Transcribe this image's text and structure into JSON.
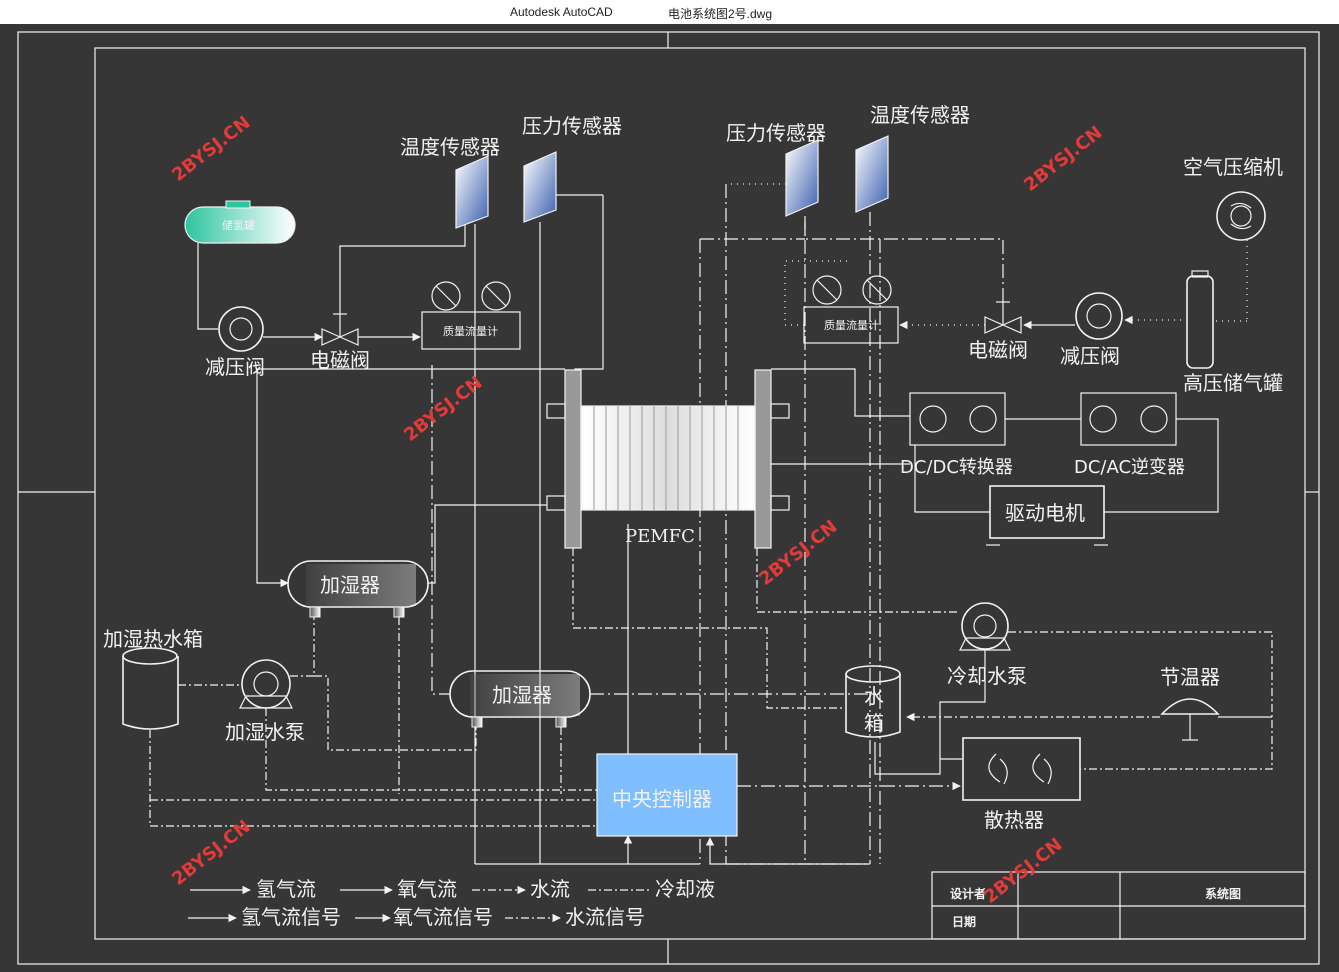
{
  "window": {
    "app": "Autodesk AutoCAD",
    "file": "电池系统图2号.dwg"
  },
  "watermark": "2BYSJ.CN",
  "labels": {
    "temp_sensor_left": "温度传感器",
    "pressure_sensor_left": "压力传感器",
    "pressure_sensor_right": "压力传感器",
    "temp_sensor_right": "温度传感器",
    "air_compressor": "空气压缩机",
    "h2_tank": "储氢罐",
    "relief_valve_left": "减压阀",
    "solenoid_valve_left": "电磁阀",
    "mass_flow_left": "质量流量计",
    "mass_flow_right": "质量流量计",
    "solenoid_valve_right": "电磁阀",
    "relief_valve_right": "减压阀",
    "hp_tank": "高压储气罐",
    "dcdc": "DC/DC转换器",
    "dcac": "DC/AC逆变器",
    "motor": "驱动电机",
    "pemfc": "PEMFC",
    "humidifier_1": "加湿器",
    "humidifier_2": "加湿器",
    "humid_tank": "加湿热水箱",
    "humid_pump": "加湿水泵",
    "cooling_pump": "冷却水泵",
    "thermostat": "节温器",
    "water_tank_1": "水",
    "water_tank_2": "箱",
    "controller": "中央控制器",
    "radiator": "散热器"
  },
  "legend": [
    {
      "label": "氢气流",
      "style": "solid"
    },
    {
      "label": "氧气流",
      "style": "solid-arrow"
    },
    {
      "label": "水流",
      "style": "arrow-dot"
    },
    {
      "label": "冷却液",
      "style": "coolant"
    },
    {
      "label": "氢气流信号",
      "style": "solid"
    },
    {
      "label": "氧气流信号",
      "style": "solid-arrow"
    },
    {
      "label": "水流信号",
      "style": "arrow-dot"
    }
  ],
  "title_block": {
    "designer": "设计者",
    "drawing_name": "系统图",
    "date": "日期"
  },
  "colors": {
    "background": "#363636",
    "line": "#f2f2f2",
    "controller": "#7fbfff",
    "sensor": "#3a5fae",
    "h2_tank": "#2ec4a0",
    "watermark": "#e33a3a"
  }
}
